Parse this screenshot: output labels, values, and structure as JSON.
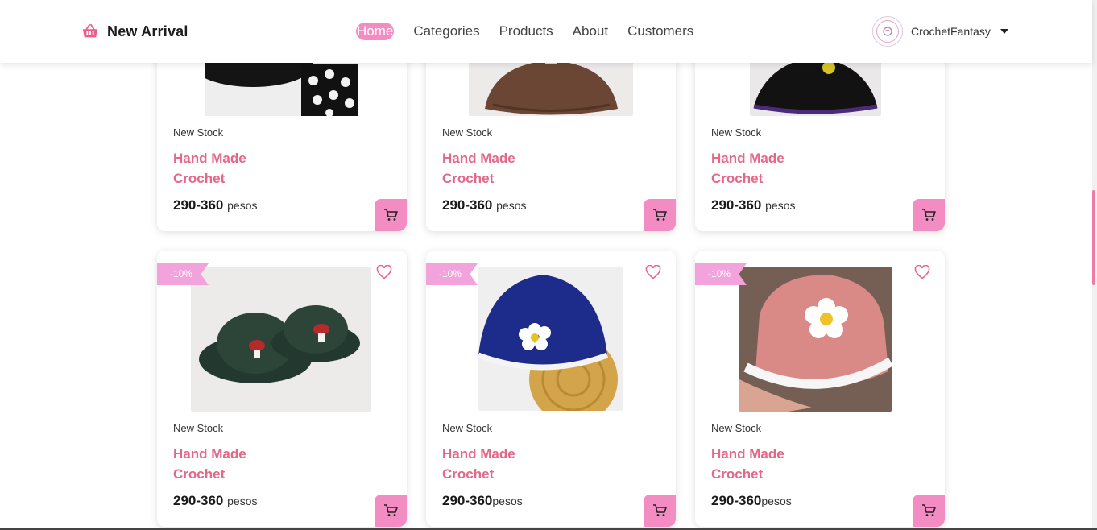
{
  "header": {
    "brand_title": "New Arrival",
    "nav": [
      {
        "label": "Home",
        "active": true
      },
      {
        "label": "Categories"
      },
      {
        "label": "Products"
      },
      {
        "label": "About"
      },
      {
        "label": "Customers"
      }
    ],
    "user_name": "CrochetFantasy"
  },
  "colors": {
    "accent_pink": "#f48cc4",
    "title_pink": "#e3688a",
    "ribbon_pink": "#f2a3dc"
  },
  "products_row1": [
    {
      "stock": "New Stock",
      "title": "Hand Made Crochet",
      "price": "290-360",
      "unit": "pesos"
    },
    {
      "stock": "New Stock",
      "title": "Hand Made Crochet",
      "price": "290-360",
      "unit": "pesos"
    },
    {
      "stock": "New Stock",
      "title": "Hand Made Crochet",
      "price": "290-360",
      "unit": "pesos"
    }
  ],
  "products_row2": [
    {
      "discount": "-10%",
      "stock": "New Stock",
      "title": "Hand Made Crochet",
      "price": "290-360",
      "unit": "pesos"
    },
    {
      "discount": "-10%",
      "stock": "New Stock",
      "title": "Hand Made Crochet",
      "price": "290-360",
      "unit": "pesos"
    },
    {
      "discount": "-10%",
      "stock": "New Stock",
      "title": "Hand Made Crochet",
      "price": "290-360",
      "unit": "pesos"
    }
  ]
}
